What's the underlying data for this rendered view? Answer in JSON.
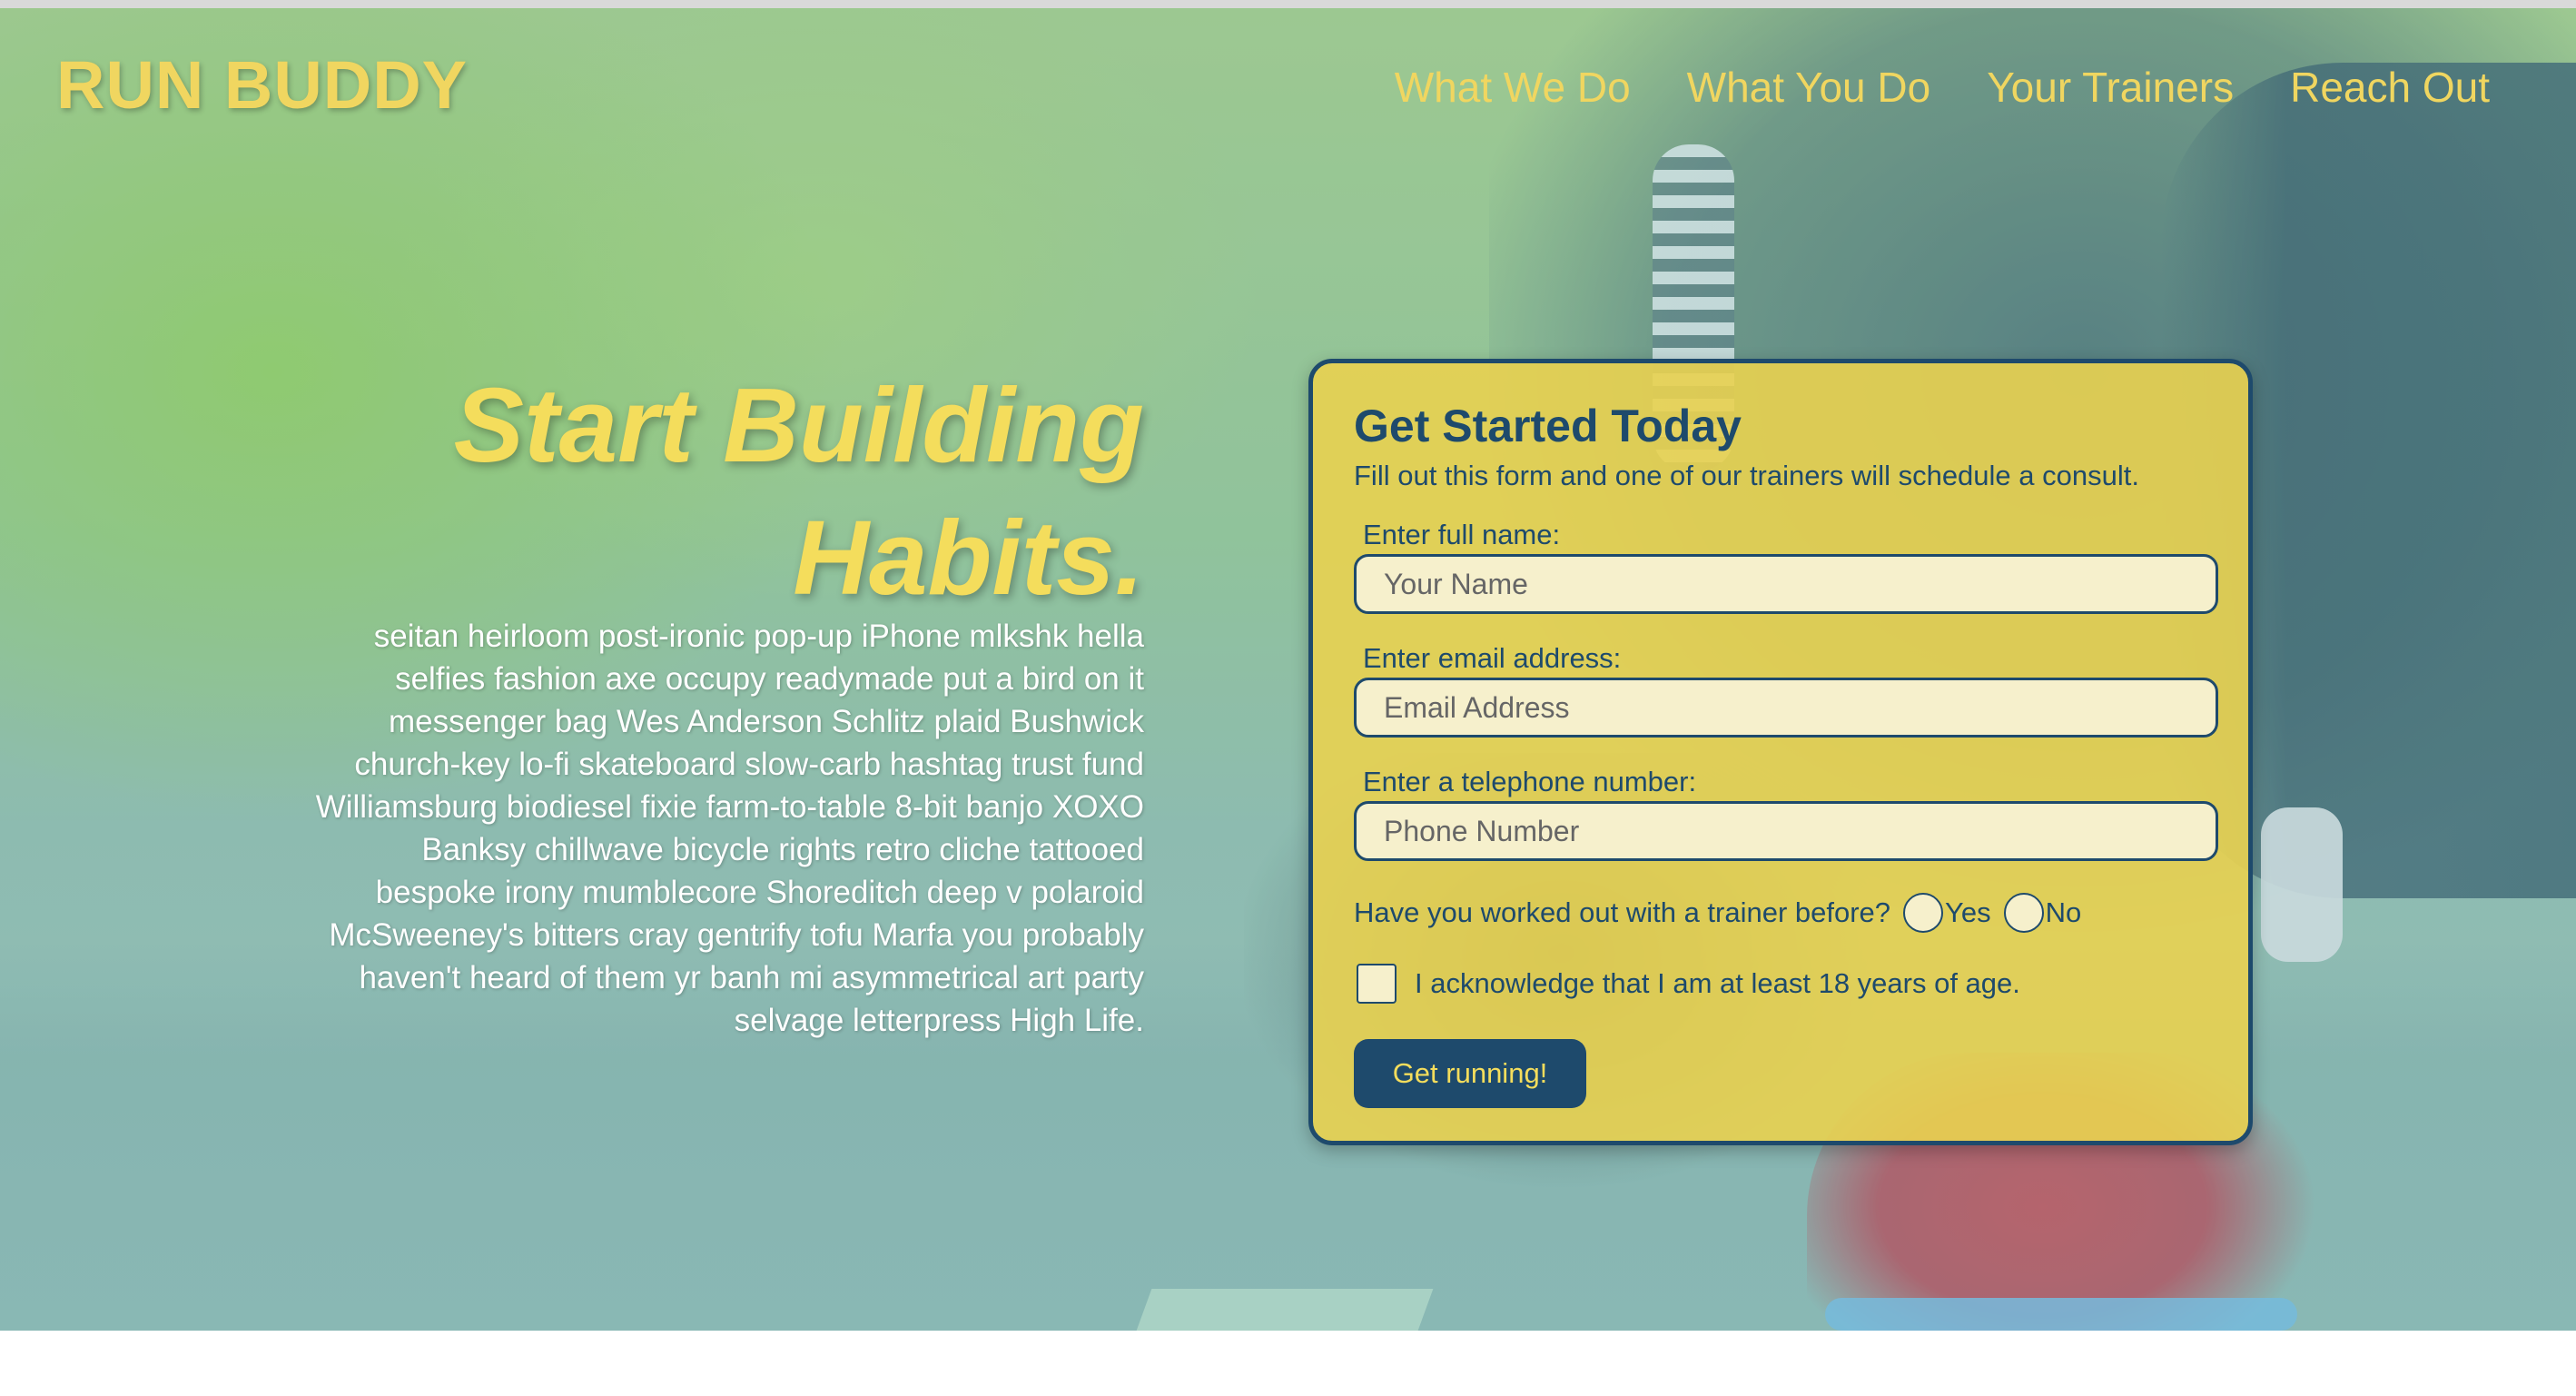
{
  "header": {
    "brand": "RUN BUDDY",
    "nav": [
      {
        "label": "What We Do"
      },
      {
        "label": "What You Do"
      },
      {
        "label": "Your Trainers"
      },
      {
        "label": "Reach Out"
      }
    ]
  },
  "hero": {
    "title_line1": "Start Building",
    "title_line2": "Habits.",
    "body": "seitan heirloom post-ironic pop-up iPhone mlkshk hella selfies fashion axe occupy readymade put a bird on it messenger bag Wes Anderson Schlitz plaid Bushwick church-key lo-fi skateboard slow-carb hashtag trust fund Williamsburg biodiesel fixie farm-to-table 8-bit banjo XOXO Banksy chillwave bicycle rights retro cliche tattooed bespoke irony mumblecore Shoreditch deep v polaroid McSweeney's bitters cray gentrify tofu Marfa you probably haven't heard of them yr banh mi asymmetrical art party selvage letterpress High Life."
  },
  "form": {
    "title": "Get Started Today",
    "subtitle": "Fill out this form and one of our trainers will schedule a consult.",
    "name": {
      "label": "Enter full name:",
      "placeholder": "Your Name",
      "value": ""
    },
    "email": {
      "label": "Enter email address:",
      "placeholder": "Email Address",
      "value": ""
    },
    "phone": {
      "label": "Enter a telephone number:",
      "placeholder": "Phone Number",
      "value": ""
    },
    "trainer_question": "Have you worked out with a trainer before?",
    "radio_yes": "Yes",
    "radio_no": "No",
    "acknowledge": "I acknowledge that I am at least 18 years of age.",
    "submit_label": "Get running!"
  },
  "colors": {
    "brand_yellow": "#f0d660",
    "navy": "#1e4a6c",
    "input_bg": "#f6f0cc"
  }
}
